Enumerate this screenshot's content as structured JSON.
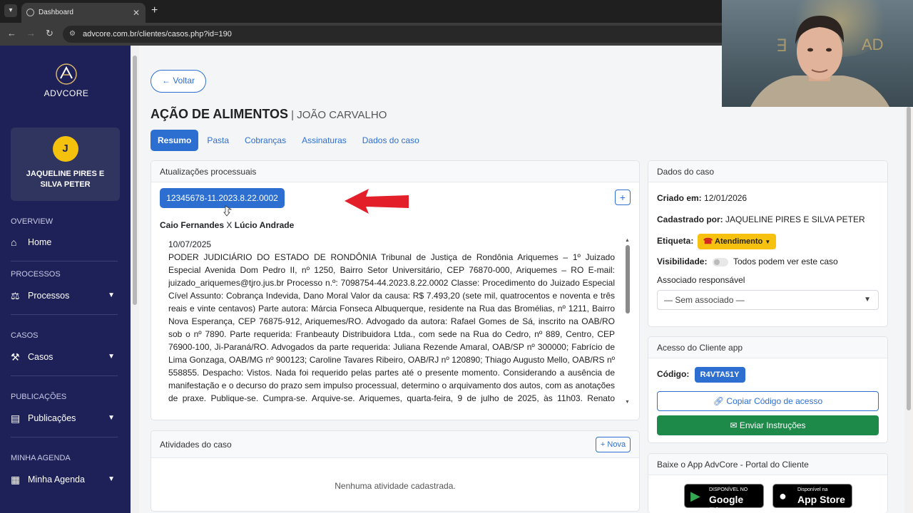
{
  "browser": {
    "tab_title": "Dashboard",
    "url": "advcore.com.br/clientes/casos.php?id=190"
  },
  "sidebar": {
    "logo_text": "ADVCORE",
    "user": {
      "initial": "J",
      "name": "JAQUELINE PIRES E SILVA PETER"
    },
    "sections": [
      {
        "label": "OVERVIEW",
        "item": "Home"
      },
      {
        "label": "PROCESSOS",
        "item": "Processos"
      },
      {
        "label": "CASOS",
        "item": "Casos"
      },
      {
        "label": "PUBLICAÇÕES",
        "item": "Publicações"
      },
      {
        "label": "MINHA AGENDA",
        "item": "Minha Agenda"
      }
    ]
  },
  "main": {
    "back_label": "Voltar",
    "title": "AÇÃO DE ALIMENTOS",
    "title_sep": " | ",
    "client": "JOÃO CARVALHO",
    "tabs": [
      "Resumo",
      "Pasta",
      "Cobranças",
      "Assinaturas",
      "Dados do caso"
    ],
    "updates": {
      "header": "Atualizações processuais",
      "process_number": "12345678-11.2023.8.22.0002",
      "party_a": "Caio Fernandes",
      "versus": "X",
      "party_b": "Lúcio Andrade",
      "date": "10/07/2025",
      "text": "PODER JUDICIÁRIO DO ESTADO DE RONDÔNIA Tribunal de Justiça de Rondônia Ariquemes – 1º Juizado Especial Avenida Dom Pedro II, nº 1250, Bairro Setor Universitário, CEP 76870-000, Ariquemes – RO E-mail: juizado_ariquemes@tjro.jus.br Processo n.º: 7098754-44.2023.8.22.0002 Classe: Procedimento do Juizado Especial Cível Assunto: Cobrança Indevida, Dano Moral Valor da causa: R$ 7.493,20 (sete mil, quatrocentos e noventa e três reais e vinte centavos) Parte autora: Márcia Fonseca Albuquerque, residente na Rua das Bromélias, nº 1211, Bairro Nova Esperança, CEP 76875-912, Ariquemes/RO. Advogado da autora: Rafael Gomes de Sá, inscrito na OAB/RO sob o nº 7890. Parte requerida: Franbeauty Distribuidora Ltda., com sede na Rua do Cedro, nº 889, Centro, CEP 76900-100, Ji-Paraná/RO. Advogados da parte requerida: Juliana Rezende Amaral, OAB/SP nº 300000; Fabrício de Lima Gonzaga, OAB/MG nº 900123; Caroline Tavares Ribeiro, OAB/RJ nº 120890; Thiago Augusto Mello, OAB/RS nº 558855. Despacho: Vistos. Nada foi requerido pelas partes até o presente momento. Considerando a ausência de manifestação e o decurso do prazo sem impulso processual, determino o arquivamento dos autos, com as anotações de praxe. Publique-se. Cumpra-se. Arquive-se. Ariquemes, quarta-feira, 9 de julho de 2025, às 11h03. Renato Oliveira"
    },
    "activities": {
      "header": "Atividades do caso",
      "new_label": "Nova",
      "empty": "Nenhuma atividade cadastrada."
    }
  },
  "case_data": {
    "header": "Dados do caso",
    "created_label": "Criado em:",
    "created_value": "12/01/2026",
    "registered_label": "Cadastrado por:",
    "registered_value": "JAQUELINE PIRES E SILVA PETER",
    "tag_label": "Etiqueta:",
    "tag_value": "Atendimento",
    "tag_color": "#f6c20f",
    "visibility_label": "Visibilidade:",
    "visibility_value": "Todos podem ver este caso",
    "associate_label": "Associado responsável",
    "associate_value": "— Sem associado —"
  },
  "client_app": {
    "header": "Acesso do Cliente app",
    "code_label": "Código:",
    "code_value": "R4VTA51Y",
    "copy_label": "Copiar Código de acesso",
    "send_label": "Enviar Instruções"
  },
  "download": {
    "header": "Baixe o App AdvCore - Portal do Cliente",
    "google_small": "DISPONÍVEL NO",
    "google_big": "Google Play",
    "apple_small": "Disponível na",
    "apple_big": "App Store"
  },
  "colors": {
    "sidebar": "#1e2157",
    "accent": "#2d6fd1",
    "success": "#1d8a4a",
    "annotation_arrow": "#e3202a"
  }
}
